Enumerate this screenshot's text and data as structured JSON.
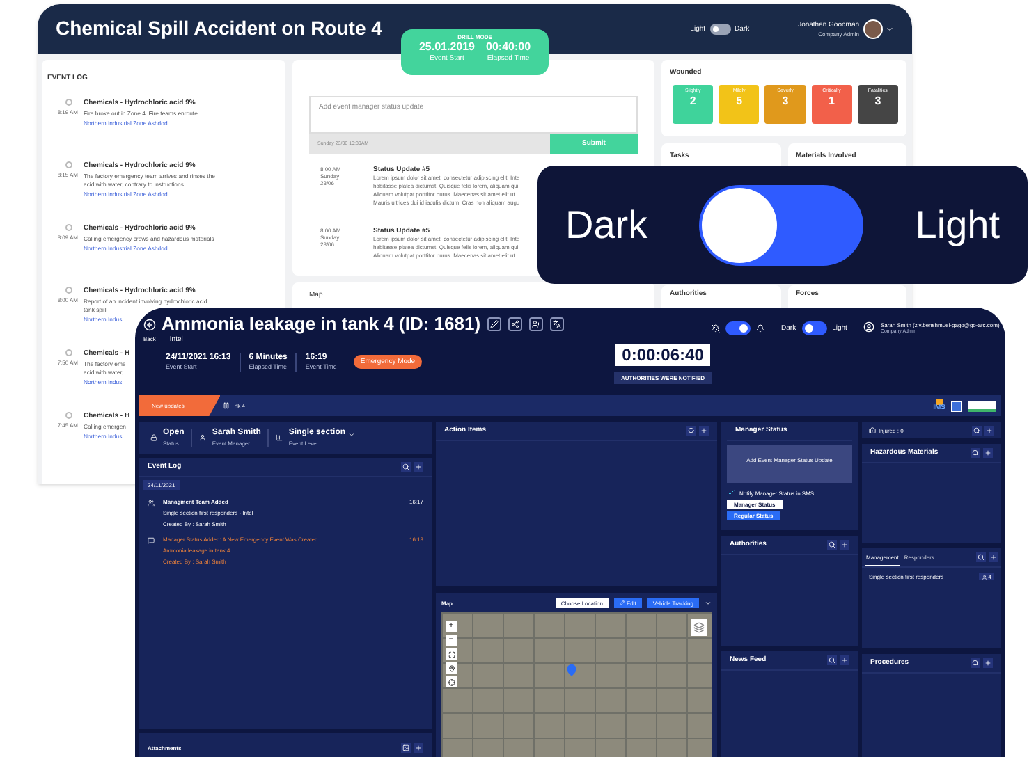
{
  "back_window": {
    "title": "Chemical Spill Accident on Route 4",
    "theme_toggle": {
      "left_label": "Light",
      "right_label": "Dark",
      "dark_mode": false
    },
    "user": {
      "name": "Jonathan Goodman",
      "role": "Company Admin"
    },
    "drill": {
      "label": "DRILL MODE",
      "stats": [
        {
          "value": "25.01.2019",
          "label": "Event Start"
        },
        {
          "value": "00:40:00",
          "label": "Elapsed Time"
        }
      ]
    },
    "event_log": {
      "title": "EVENT LOG",
      "entries": [
        {
          "time": "8:19 AM",
          "title": "Chemicals - Hydrochloric acid 9%",
          "lines": [
            "Fire broke out in Zone 4. Fire teams enroute."
          ],
          "link": "Northern Industrial Zone Ashdod"
        },
        {
          "time": "8:15 AM",
          "title": "Chemicals - Hydrochloric acid 9%",
          "lines": [
            "The factory emergency team arrives and rinses the",
            "acid with water, contrary to instructions."
          ],
          "link": "Northern Industrial Zone Ashdod"
        },
        {
          "time": "8:09 AM",
          "title": "Chemicals - Hydrochloric acid 9%",
          "lines": [
            "Calling emergency crews and hazardous materials"
          ],
          "link": "Northern Industrial Zone Ashdod"
        },
        {
          "time": "8:00 AM",
          "title": "Chemicals - Hydrochloric acid 9%",
          "lines": [
            "Report of an incident involving hydrochloric acid",
            "tank spill"
          ],
          "link": "Northern Indus"
        },
        {
          "time": "7:50 AM",
          "title": "Chemicals - H",
          "lines": [
            "The factory eme",
            "acid with water,"
          ],
          "link": "Northern Indus"
        },
        {
          "time": "7:45 AM",
          "title": "Chemicals - H",
          "lines": [
            "Calling emergen"
          ],
          "link": "Northern Indus"
        }
      ]
    },
    "status_form": {
      "placeholder": "Add event manager status update",
      "timestamp": "Sunday 23/06 10:30AM",
      "submit": "Submit"
    },
    "status_updates": [
      {
        "time": "8:00 AM",
        "day": "Sunday",
        "date": "23/06",
        "title": "Status Update #5",
        "lines": [
          "Lorem ipsum dolor sit amet, consectetur adipiscing elit. Inte",
          "habitasse platea dictumst. Quisque felis lorem, aliquam qui",
          "Aliquam volutpat porttitor purus. Maecenas sit amet elit ut",
          "Mauris ultrices dui id iaculis dictum. Cras non aliquam augu"
        ]
      },
      {
        "time": "8:00 AM",
        "day": "Sunday",
        "date": "23/06",
        "title": "Status Update #5",
        "lines": [
          "Lorem ipsum dolor sit amet, consectetur adipiscing elit. Inte",
          "habitasse platea dictumst. Quisque felis lorem, aliquam qui",
          "Aliquam volutpat porttitor purus. Maecenas sit amet elit ut"
        ]
      }
    ],
    "map_title": "Map",
    "wounded": {
      "title": "Wounded",
      "tiles": [
        {
          "label": "Slightly",
          "count": "2",
          "color": "#3fd39b"
        },
        {
          "label": "Mildly",
          "count": "5",
          "color": "#f2c318"
        },
        {
          "label": "Severly",
          "count": "3",
          "color": "#e0991c"
        },
        {
          "label": "Critically",
          "count": "1",
          "color": "#f2604a"
        },
        {
          "label": "Fatalities",
          "count": "3",
          "color": "#454545"
        }
      ]
    },
    "cards": [
      "Tasks",
      "Materials Involved",
      "Authorities",
      "Forces"
    ]
  },
  "theme_callout": {
    "left_label": "Dark",
    "right_label": "Light",
    "light_mode": false
  },
  "front_window": {
    "back_label": "Back",
    "title": "Ammonia leakage in tank 4 (ID: 1681)",
    "subtitle": "Intel",
    "stats": [
      {
        "value": "24/11/2021 16:13",
        "label": "Event Start"
      },
      {
        "value": "6 Minutes",
        "label": "Elapsed Time"
      },
      {
        "value": "16:19",
        "label": "Event Time"
      }
    ],
    "mode_badge": "Emergency Mode",
    "timer": "0:00:06:40",
    "notice": "AUTHORITIES WERE NOTIFIED",
    "alert_toggle": {
      "on": true
    },
    "theme_toggle": {
      "left_label": "Dark",
      "right_label": "Light",
      "light_mode": false
    },
    "user": {
      "name": "Sarah Smith (ziv.benshmuel-gago@go-arc.com)",
      "role": "Company Admin"
    },
    "ticker": {
      "label": "New updates",
      "text": "nk 4",
      "logo_caption": "IMS"
    },
    "summary": [
      {
        "kind": "lock",
        "value": "Open",
        "label": "Status"
      },
      {
        "kind": "person",
        "value": "Sarah Smith",
        "label": "Event Manager"
      },
      {
        "kind": "chart",
        "value": "Single section",
        "label": "Event Level"
      }
    ],
    "event_log": {
      "title": "Event Log",
      "date": "24/11/2021",
      "entries": [
        {
          "kind": "team",
          "title": "Managment Team Added",
          "time": "16:17",
          "lines": [
            "Single section first responders - Intel",
            "Created By : Sarah Smith"
          ]
        },
        {
          "kind": "status",
          "title": "Manager Status Added: A New Emergency Event Was Created",
          "time": "16:13",
          "lines": [
            "Ammonia leakage in tank 4",
            "Created By : Sarah Smith"
          ]
        }
      ]
    },
    "attachments_title": "Attachments",
    "action_items_title": "Action Items",
    "map": {
      "title": "Map",
      "buttons": [
        {
          "kind": "plain",
          "label": "Choose Location"
        },
        {
          "kind": "edit",
          "label": "Edit"
        },
        {
          "kind": "primary",
          "label": "Vehicle Tracking"
        }
      ],
      "zoom_in": "+",
      "zoom_out": "−"
    },
    "manager_status": {
      "title": "Manager Status",
      "placeholder": "Add Event Manager Status Update",
      "notify": {
        "label": "Notify Manager Status in SMS",
        "checked": true
      },
      "types": [
        {
          "label": "Manager Status",
          "selected": false
        },
        {
          "label": "Regular Status",
          "selected": true
        }
      ]
    },
    "authorities_title": "Authorities",
    "news_feed_title": "News Feed",
    "injured": "Injured : 0",
    "hazardous_title": "Hazardous Materials",
    "team_tabs": [
      {
        "label": "Management",
        "selected": true
      },
      {
        "label": "Responders",
        "selected": false
      }
    ],
    "team_rows": [
      {
        "name": "Single section first responders",
        "count": "4"
      }
    ],
    "procedures_title": "Procedures"
  }
}
